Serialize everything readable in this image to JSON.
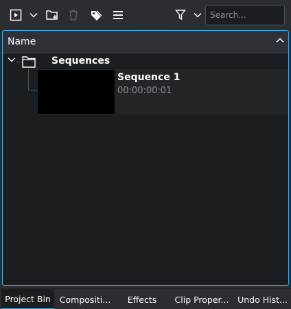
{
  "toolbar": {
    "buttons": [
      {
        "icon": "add-clip-icon"
      },
      {
        "icon": "chevron-down-icon"
      },
      {
        "icon": "add-folder-icon"
      },
      {
        "icon": "delete-icon"
      },
      {
        "icon": "tag-icon"
      },
      {
        "icon": "menu-icon"
      },
      {
        "icon": "filter-icon"
      },
      {
        "icon": "chevron-down-icon"
      }
    ],
    "search_placeholder": "Search..."
  },
  "tree": {
    "column_header": "Name",
    "folder": {
      "label": "Sequences",
      "expanded": true,
      "items": [
        {
          "name": "Sequence 1",
          "duration": "00:00:00:01"
        }
      ]
    }
  },
  "tabs": [
    {
      "label": "Project Bin",
      "active": true
    },
    {
      "label": "Compositi...",
      "active": false
    },
    {
      "label": "Effects",
      "active": false
    },
    {
      "label": "Clip Proper...",
      "active": false
    },
    {
      "label": "Undo Hist...",
      "active": false
    }
  ],
  "colors": {
    "accent": "#3daee9",
    "background": "#2a2e32",
    "view_background": "#1b1e20"
  }
}
